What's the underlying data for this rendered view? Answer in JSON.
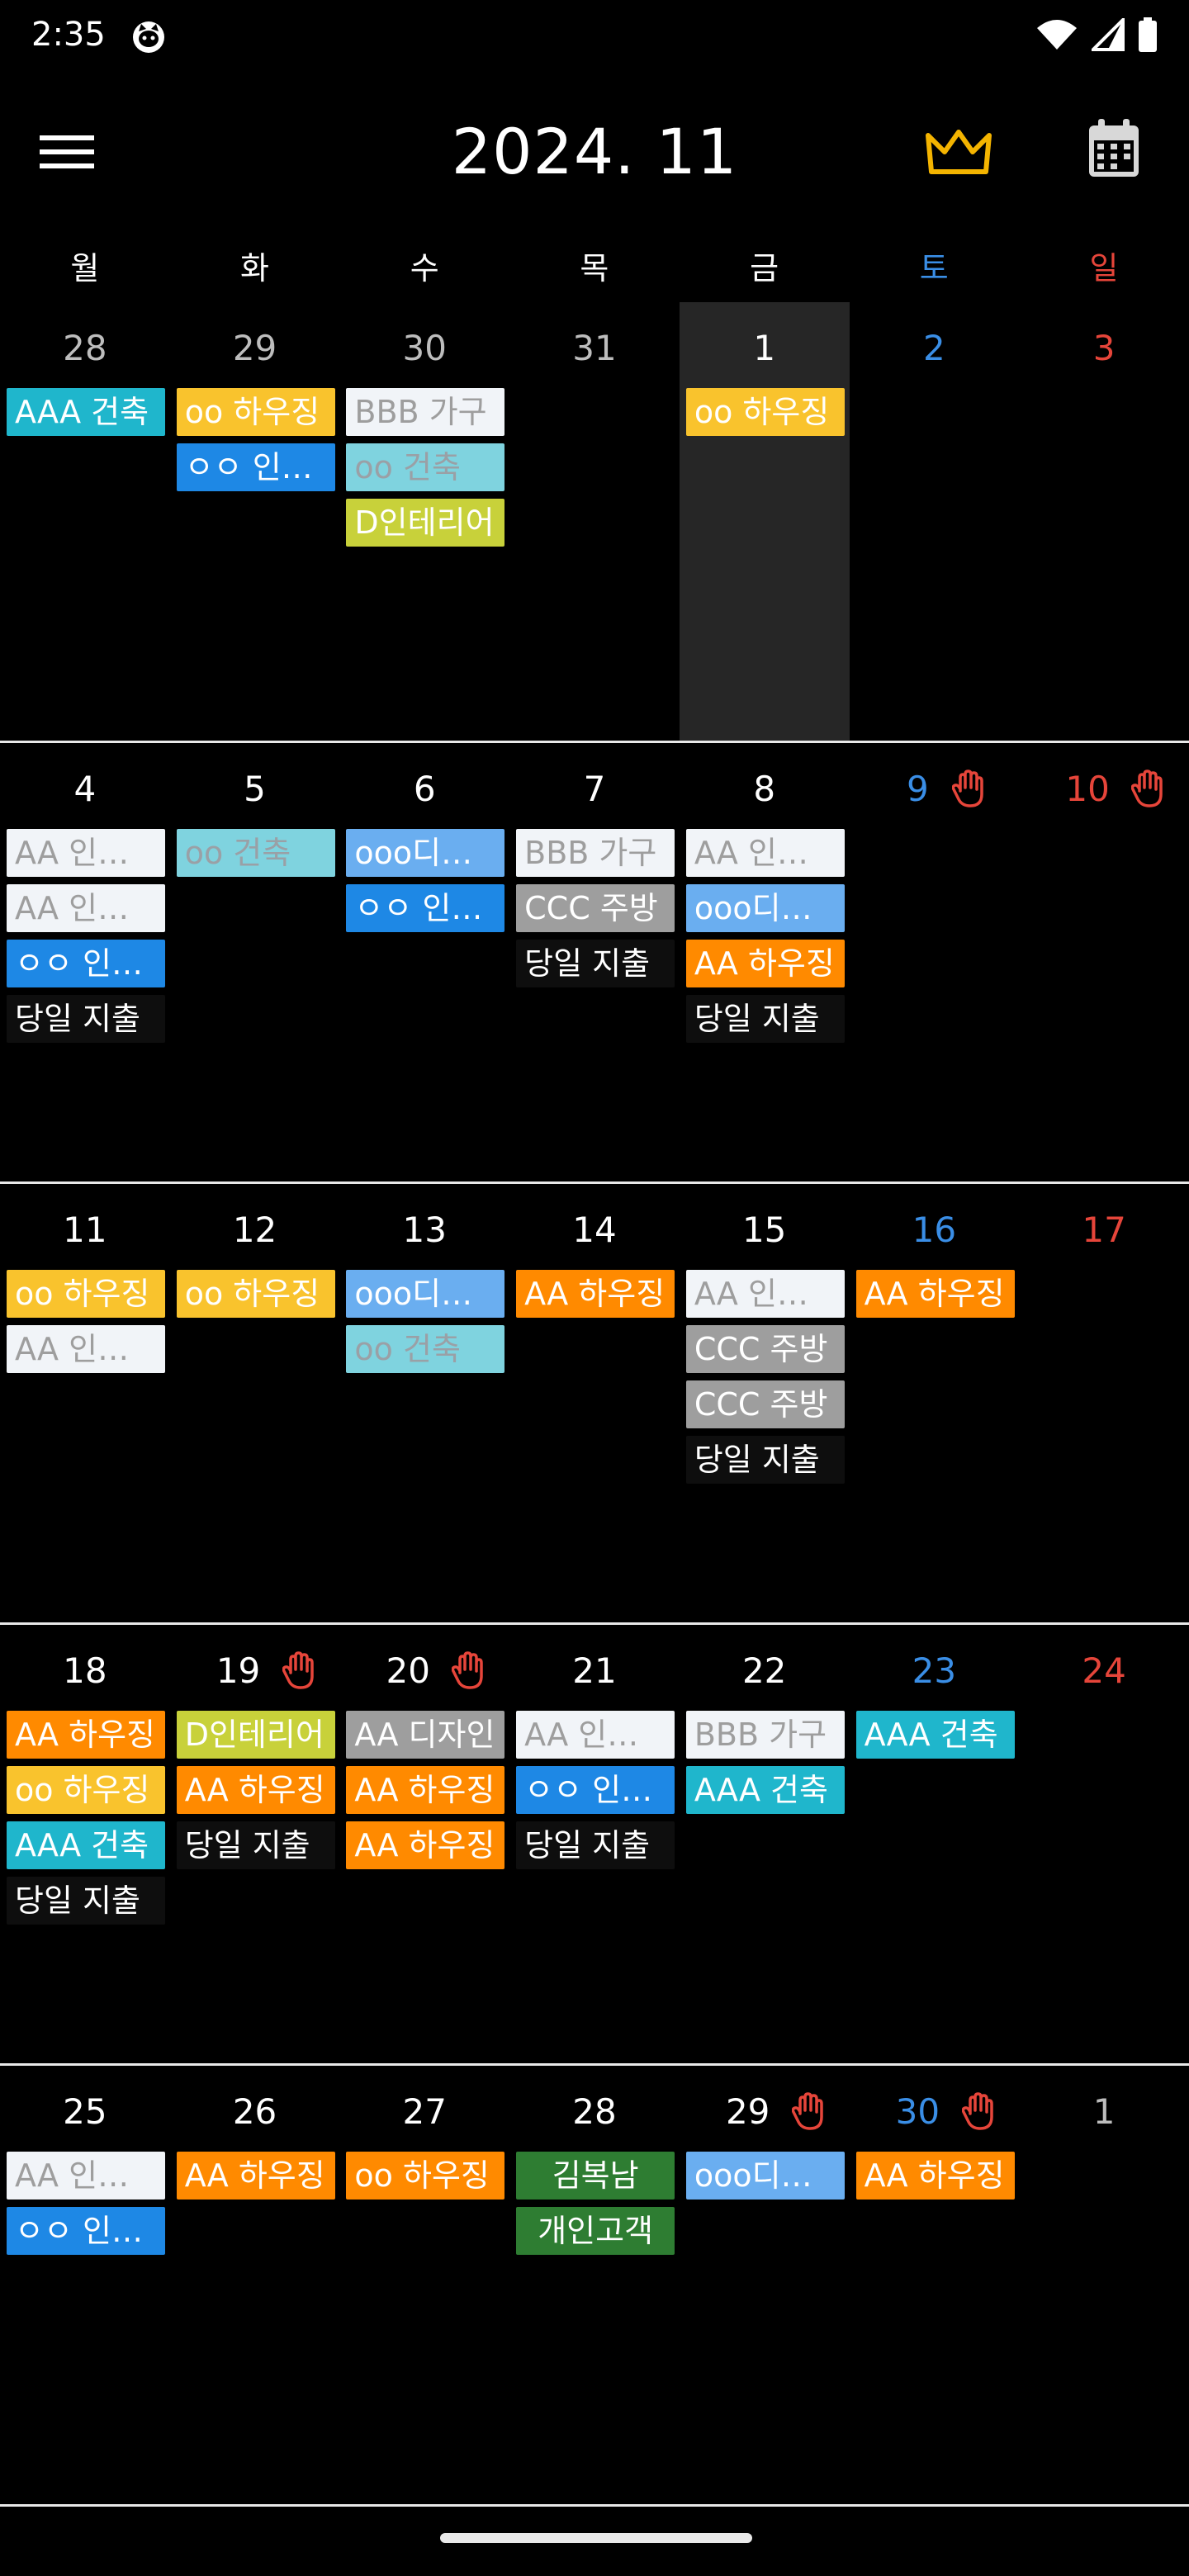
{
  "status": {
    "time": "2:35"
  },
  "header": {
    "title": "2024. 11"
  },
  "colors": {
    "sat": "#3a8ee6",
    "sun": "#e6453a",
    "crown": "#f4b400",
    "cyan": "#1fb6cc",
    "yellow": "#f9c32d",
    "blue": "#1e88e5",
    "white": "#f1f4f8",
    "lcyan": "#7fd3df",
    "lime": "#c8d13a",
    "sky": "#6aaef0",
    "gray": "#9e9e9e",
    "black": "#0e0e0e",
    "orange": "#ff8a00",
    "green": "#2e7d32"
  },
  "icons": {
    "menu": "menu-icon",
    "crown": "crown-icon",
    "calendar": "calendar-icon",
    "hand": "hand-icon"
  },
  "weekdays": [
    "월",
    "화",
    "수",
    "목",
    "금",
    "토",
    "일"
  ],
  "weeks": [
    {
      "days": [
        {
          "num": "28",
          "other": true,
          "events": [
            {
              "label": "AAA 건축",
              "color": "cyan"
            }
          ]
        },
        {
          "num": "29",
          "other": true,
          "events": [
            {
              "label": "oo 하우징",
              "color": "yellow"
            },
            {
              "label": "ㅇㅇ 인테리어",
              "color": "blue"
            }
          ]
        },
        {
          "num": "30",
          "other": true,
          "events": [
            {
              "label": "BBB 가구",
              "color": "white"
            },
            {
              "label": "oo 건축",
              "color": "lcyan"
            },
            {
              "label": "D인테리어",
              "color": "lime"
            }
          ]
        },
        {
          "num": "31",
          "other": true,
          "events": []
        },
        {
          "num": "1",
          "today": true,
          "events": [
            {
              "label": "oo 하우징",
              "color": "yellow"
            }
          ]
        },
        {
          "num": "2",
          "events": []
        },
        {
          "num": "3",
          "events": []
        }
      ]
    },
    {
      "days": [
        {
          "num": "4",
          "events": [
            {
              "label": "AA 인테리어",
              "color": "white"
            },
            {
              "label": "AA 인테리어",
              "color": "white"
            },
            {
              "label": "ㅇㅇ 인테리어",
              "color": "blue"
            },
            {
              "label": "당일 지출",
              "color": "black"
            }
          ]
        },
        {
          "num": "5",
          "events": [
            {
              "label": "oo 건축",
              "color": "lcyan"
            }
          ]
        },
        {
          "num": "6",
          "events": [
            {
              "label": "ooo디자인",
              "color": "sky"
            },
            {
              "label": "ㅇㅇ 인테리어",
              "color": "blue"
            }
          ]
        },
        {
          "num": "7",
          "events": [
            {
              "label": "BBB 가구",
              "color": "white"
            },
            {
              "label": "CCC 주방",
              "color": "gray"
            },
            {
              "label": "당일 지출",
              "color": "black"
            }
          ]
        },
        {
          "num": "8",
          "events": [
            {
              "label": "AA 인테리어",
              "color": "white"
            },
            {
              "label": "ooo디자인",
              "color": "sky"
            },
            {
              "label": "AA 하우징",
              "color": "orange"
            },
            {
              "label": "당일 지출",
              "color": "black"
            }
          ]
        },
        {
          "num": "9",
          "hand": true,
          "events": []
        },
        {
          "num": "10",
          "hand": true,
          "events": []
        }
      ]
    },
    {
      "days": [
        {
          "num": "11",
          "events": [
            {
              "label": "oo 하우징",
              "color": "yellow"
            },
            {
              "label": "AA 인테리어",
              "color": "white"
            }
          ]
        },
        {
          "num": "12",
          "events": [
            {
              "label": "oo 하우징",
              "color": "yellow"
            }
          ]
        },
        {
          "num": "13",
          "events": [
            {
              "label": "ooo디자인",
              "color": "sky"
            },
            {
              "label": "oo 건축",
              "color": "lcyan"
            }
          ]
        },
        {
          "num": "14",
          "events": [
            {
              "label": "AA 하우징",
              "color": "orange"
            }
          ]
        },
        {
          "num": "15",
          "events": [
            {
              "label": "AA 인테리어",
              "color": "white"
            },
            {
              "label": "CCC 주방",
              "color": "gray"
            },
            {
              "label": "CCC 주방",
              "color": "gray"
            },
            {
              "label": "당일 지출",
              "color": "black"
            }
          ]
        },
        {
          "num": "16",
          "events": [
            {
              "label": "AA 하우징",
              "color": "orange"
            }
          ]
        },
        {
          "num": "17",
          "events": []
        }
      ]
    },
    {
      "days": [
        {
          "num": "18",
          "events": [
            {
              "label": "AA 하우징",
              "color": "orange"
            },
            {
              "label": "oo 하우징",
              "color": "yellow"
            },
            {
              "label": "AAA 건축",
              "color": "cyan"
            },
            {
              "label": "당일 지출",
              "color": "black"
            }
          ]
        },
        {
          "num": "19",
          "hand": true,
          "events": [
            {
              "label": "D인테리어",
              "color": "lime"
            },
            {
              "label": "AA 하우징",
              "color": "orange"
            },
            {
              "label": "당일 지출",
              "color": "black"
            }
          ]
        },
        {
          "num": "20",
          "hand": true,
          "events": [
            {
              "label": "AA 디자인",
              "color": "gray"
            },
            {
              "label": "AA 하우징",
              "color": "orange"
            },
            {
              "label": "AA 하우징",
              "color": "orange"
            }
          ]
        },
        {
          "num": "21",
          "events": [
            {
              "label": "AA 인테리어",
              "color": "white"
            },
            {
              "label": "ㅇㅇ 인테리어",
              "color": "blue"
            },
            {
              "label": "당일 지출",
              "color": "black"
            }
          ]
        },
        {
          "num": "22",
          "events": [
            {
              "label": "BBB 가구",
              "color": "white"
            },
            {
              "label": "AAA 건축",
              "color": "cyan"
            }
          ]
        },
        {
          "num": "23",
          "events": [
            {
              "label": "AAA 건축",
              "color": "cyan"
            }
          ]
        },
        {
          "num": "24",
          "events": []
        }
      ]
    },
    {
      "days": [
        {
          "num": "25",
          "events": [
            {
              "label": "AA 인테리어",
              "color": "white"
            },
            {
              "label": "ㅇㅇ 인테리어",
              "color": "blue"
            }
          ]
        },
        {
          "num": "26",
          "events": [
            {
              "label": "AA 하우징",
              "color": "orange"
            }
          ]
        },
        {
          "num": "27",
          "events": [
            {
              "label": "oo 하우징",
              "color": "orange"
            }
          ]
        },
        {
          "num": "28",
          "events": [
            {
              "label": "김복남",
              "color": "green"
            },
            {
              "label": "개인고객",
              "color": "green"
            }
          ]
        },
        {
          "num": "29",
          "hand": true,
          "events": [
            {
              "label": "ooo디자인",
              "color": "sky"
            }
          ]
        },
        {
          "num": "30",
          "hand": true,
          "events": [
            {
              "label": "AA 하우징",
              "color": "orange"
            }
          ]
        },
        {
          "num": "1",
          "other": true,
          "events": []
        }
      ]
    }
  ]
}
